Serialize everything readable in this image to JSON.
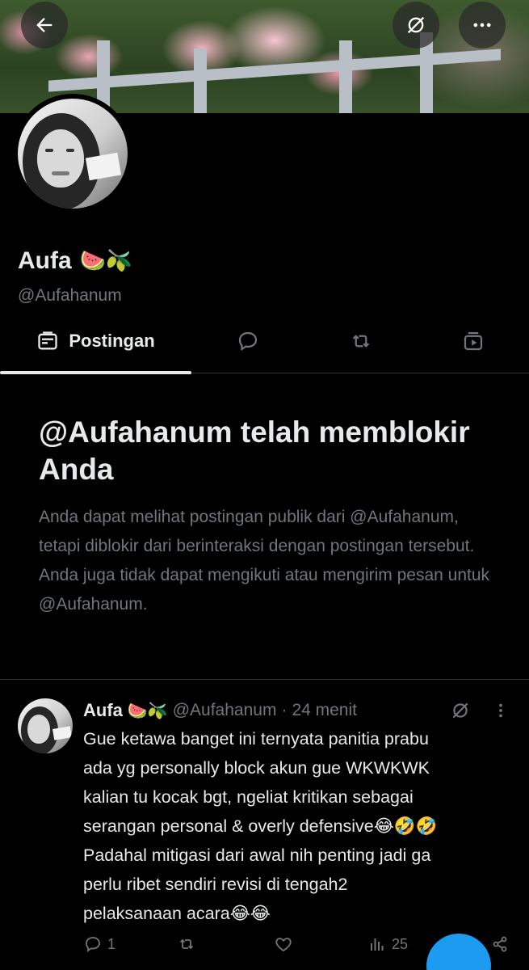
{
  "profile": {
    "name": "Aufa",
    "name_emoji": "🍉🫒",
    "handle": "@Aufahanum"
  },
  "tabs": [
    {
      "label": "Postingan",
      "icon": "timeline-icon",
      "selected": true
    },
    {
      "label": "",
      "icon": "reply-bubble-icon",
      "selected": false
    },
    {
      "label": "",
      "icon": "repost-icon",
      "selected": false
    },
    {
      "label": "",
      "icon": "video-icon",
      "selected": false
    }
  ],
  "blocked": {
    "title": "@Aufahanum telah memblokir Anda",
    "description": "Anda dapat melihat postingan publik dari @Aufahanum, tetapi diblokir dari berinteraksi dengan postingan tersebut. Anda juga tidak dapat mengikuti atau mengirim pesan untuk @Aufahanum."
  },
  "post": {
    "name": "Aufa",
    "name_emoji": "🍉🫒",
    "handle": "@Aufahanum",
    "separator": "·",
    "time": "24 menit",
    "lines": [
      "Gue ketawa banget ini ternyata panitia prabu",
      "ada yg personally block akun gue WKWKWK",
      "kalian tu kocak bgt, ngeliat kritikan sebagai",
      "serangan personal & overly defensive😂🤣🤣",
      "Padahal mitigasi dari awal nih penting jadi ga",
      "perlu ribet sendiri revisi di tengah2",
      "pelaksanaan acara😂😂"
    ],
    "reply_count": "1",
    "retweet_count": "",
    "like_count": "",
    "views_count": "25"
  },
  "colors": {
    "background": "#000000",
    "text_primary": "#e7e9ea",
    "text_secondary": "#71767b",
    "divider": "#2f3336",
    "accent": "#1d9bf0"
  }
}
